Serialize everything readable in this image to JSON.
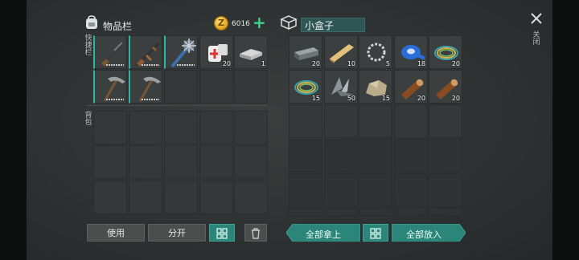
{
  "inventory": {
    "title": "物品栏",
    "side_label": "快捷栏",
    "backpack_label": "背包"
  },
  "currency": {
    "amount": "6016"
  },
  "container": {
    "name": "小盒子"
  },
  "close": {
    "label": "关闭"
  },
  "buttons": {
    "use": "使用",
    "split": "分开",
    "take_all": "全部拿上",
    "put_all": "全部放入"
  },
  "hotbar": [
    {
      "icon": "shotgun-icon",
      "count": "",
      "durability": true
    },
    {
      "icon": "assault-rifle-icon",
      "count": "",
      "durability": true
    },
    {
      "icon": "spiked-club-icon",
      "count": "",
      "durability": true
    },
    {
      "icon": "medkit-icon",
      "count": "20"
    },
    {
      "icon": "metal-ingots-icon",
      "count": "1"
    },
    {
      "icon": "pickaxe-icon",
      "count": "",
      "durability": true
    },
    {
      "icon": "pickaxe-icon",
      "count": "",
      "durability": true
    }
  ],
  "box_items": [
    {
      "icon": "iron-bar-icon",
      "count": "20"
    },
    {
      "icon": "wooden-plank-icon",
      "count": "10"
    },
    {
      "icon": "metal-chain-icon",
      "count": "5"
    },
    {
      "icon": "blue-tape-icon",
      "count": "18"
    },
    {
      "icon": "wire-coil-icon",
      "count": "20"
    },
    {
      "icon": "wire-coil-icon",
      "count": "15"
    },
    {
      "icon": "metal-scraps-icon",
      "count": "50"
    },
    {
      "icon": "stone-icon",
      "count": "15"
    },
    {
      "icon": "wood-log-icon",
      "count": "20"
    },
    {
      "icon": "wood-log-icon",
      "count": "20"
    }
  ]
}
